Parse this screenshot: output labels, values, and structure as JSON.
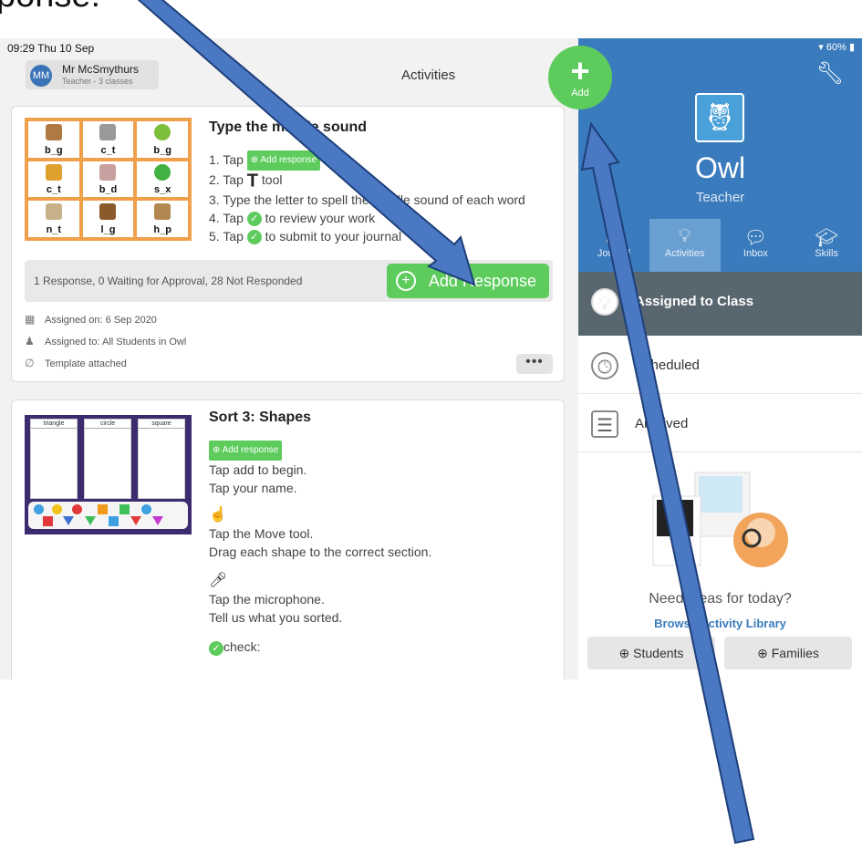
{
  "overlay_text": "ponse:",
  "status": {
    "time": "09:29  Thu 10 Sep",
    "battery": "▾ 60% ▮"
  },
  "user": {
    "initials": "MM",
    "name": "Mr McSmythurs",
    "subtitle": "Teacher - 3 classes"
  },
  "page_title": "Activities",
  "activity1": {
    "title": "Type the middle sound",
    "words": [
      "b_g",
      "c_t",
      "b_g",
      "c_t",
      "b_d",
      "s_x",
      "n_t",
      "l_g",
      "h_p"
    ],
    "step1_prefix": "1. Tap",
    "step1_tag": "⊕ Add response",
    "step2_prefix": "2. Tap",
    "step2_t": "T",
    "step2_suffix": "tool",
    "step3": "3. Type the letter to spell the middle sound of each word",
    "step4_prefix": "4. Tap",
    "step4_suffix": "to review your work",
    "step5_prefix": "5. Tap",
    "step5_suffix": "to submit to your journal",
    "response_summary": "1 Response, 0 Waiting for Approval, 28 Not Responded",
    "add_response_label": "Add Response",
    "assigned_on": "Assigned on: 6 Sep 2020",
    "assigned_to": "Assigned to: All Students in Owl",
    "template": "Template attached",
    "more": "•••"
  },
  "activity2": {
    "title": "Sort 3: Shapes",
    "columns": [
      "triangle",
      "circle",
      "square"
    ],
    "tag": "⊕ Add response",
    "line1": "Tap add to begin.",
    "line2": "Tap your name.",
    "line3": "Tap the Move tool.",
    "line4": "Drag each shape to the correct section.",
    "line5": "Tap the microphone.",
    "line6": "Tell us what you sorted.",
    "line7": "check:"
  },
  "fab": {
    "label": "Add"
  },
  "class": {
    "name": "Owl",
    "role": "Teacher"
  },
  "tabs": [
    {
      "label": "Journal",
      "icon": "journal-icon"
    },
    {
      "label": "Activities",
      "icon": "lightbulb-icon"
    },
    {
      "label": "Inbox",
      "icon": "chat-icon"
    },
    {
      "label": "Skills",
      "icon": "graduation-cap-icon"
    }
  ],
  "folders": {
    "assigned": "Assigned to Class",
    "scheduled": "Scheduled",
    "archived": "Archived"
  },
  "ideas": {
    "question": "Need ideas for today?",
    "browse": "Browse Activity Library"
  },
  "buttons": {
    "students": "⊕ Students",
    "families": "⊕ Families"
  },
  "colors": {
    "brand_blue": "#3a7bbd",
    "green": "#5dcc5d",
    "arrow": "#4a78c2"
  }
}
